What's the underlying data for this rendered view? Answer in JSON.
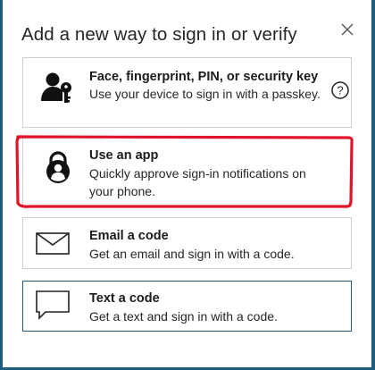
{
  "dialog": {
    "title": "Add a new way to sign in or verify",
    "close_icon": "close-icon"
  },
  "options": [
    {
      "icon": "passkey-icon",
      "title": "Face, fingerprint, PIN, or security key",
      "description": "Use your device to sign in with a passkey.",
      "help_icon": "help-icon"
    },
    {
      "icon": "authenticator-app-icon",
      "title": "Use an app",
      "description": "Quickly approve sign-in notifications on your phone."
    },
    {
      "icon": "envelope-icon",
      "title": "Email a code",
      "description": "Get an email and sign in with a code."
    },
    {
      "icon": "chat-bubble-icon",
      "title": "Text a code",
      "description": "Get a text and sign in with a code."
    }
  ],
  "colors": {
    "frame": "#1f5d7e",
    "highlight": "#e0142b",
    "option_border": "#cfcfcf",
    "focused_border": "#1f5d7e"
  }
}
